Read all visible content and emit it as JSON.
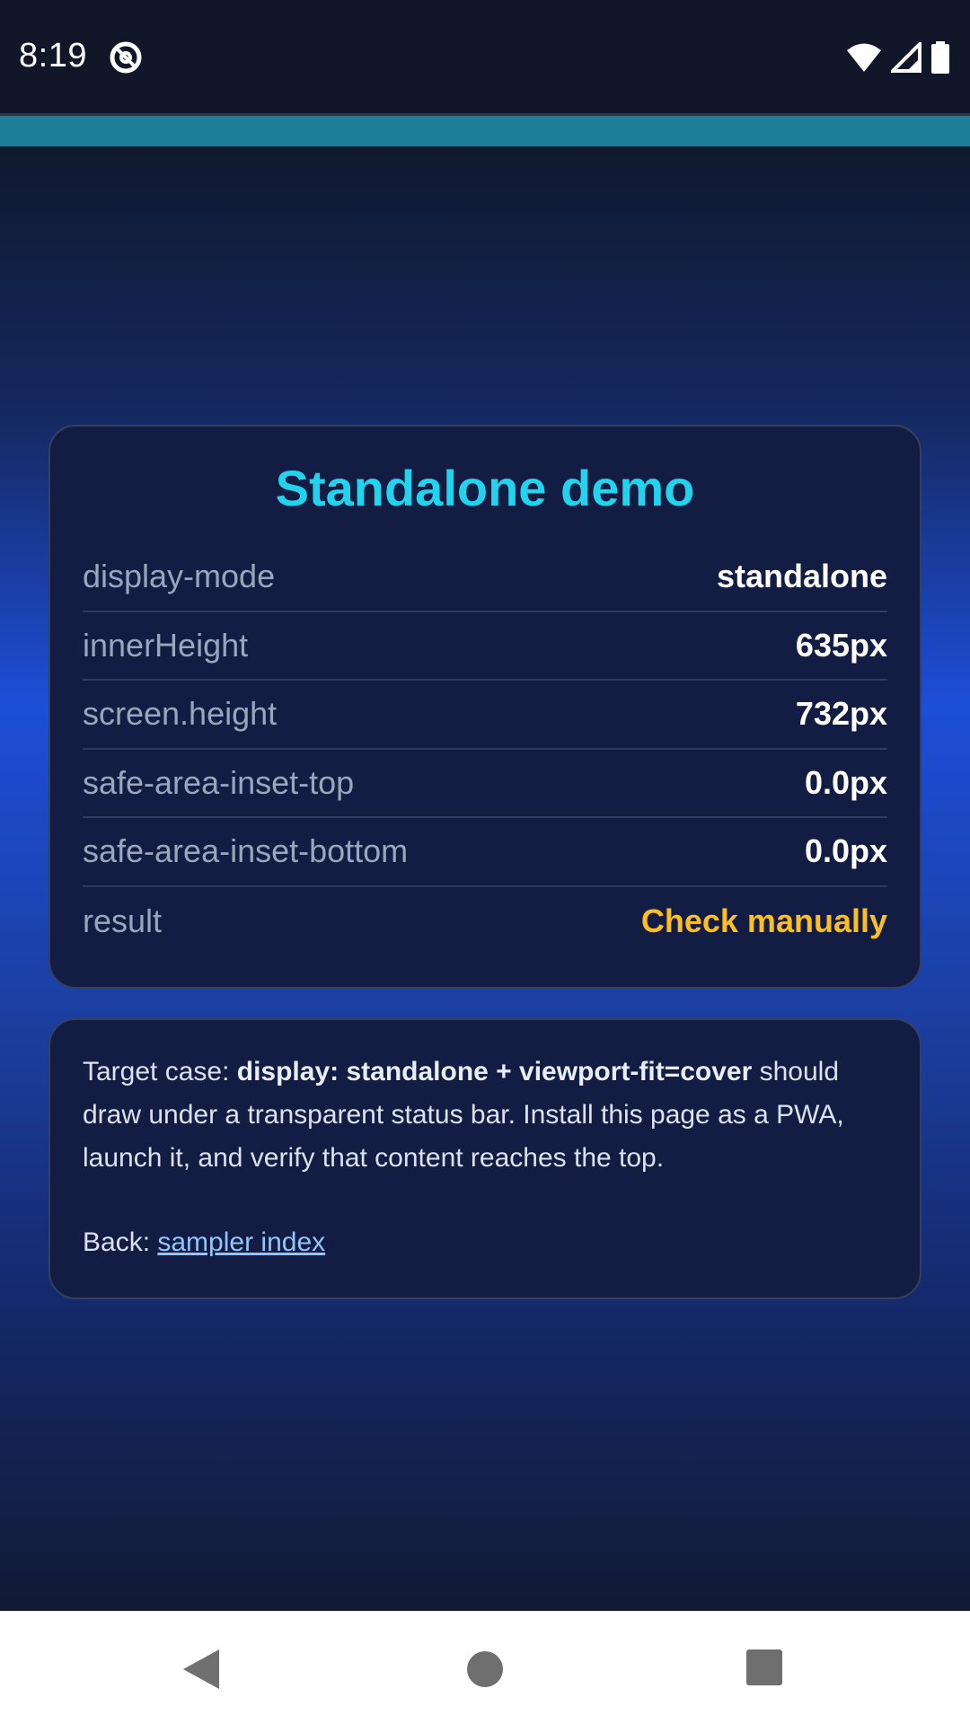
{
  "status_bar": {
    "time": "8:19",
    "icons": [
      "at-sign-icon",
      "wifi-icon",
      "signal-icon",
      "battery-icon"
    ]
  },
  "card": {
    "title": "Standalone demo",
    "rows": [
      {
        "label": "display-mode",
        "value": "standalone"
      },
      {
        "label": "innerHeight",
        "value": "635px"
      },
      {
        "label": "screen.height",
        "value": "732px"
      },
      {
        "label": "safe-area-inset-top",
        "value": "0.0px"
      },
      {
        "label": "safe-area-inset-bottom",
        "value": "0.0px"
      },
      {
        "label": "result",
        "value": "Check manually"
      }
    ]
  },
  "note": {
    "prefix": "Target case: ",
    "bold": "display: standalone + viewport-fit=cover",
    "suffix": " should draw under a transparent status bar. Install this page as a PWA, launch it, and verify that content reaches the top.",
    "back_label": "Back: ",
    "back_link": "sampler index"
  },
  "colors": {
    "title": "#22d3ee",
    "warning": "#fbbf24",
    "link": "#93c5fd",
    "accent_strip": "#1c7e98"
  },
  "nav_bar": {
    "buttons": [
      "back-icon",
      "home-icon",
      "recents-icon"
    ]
  }
}
